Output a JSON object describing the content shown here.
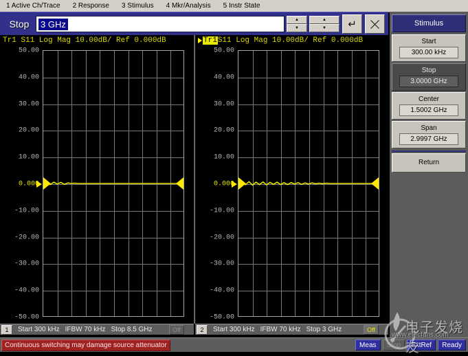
{
  "menubar": {
    "items": [
      {
        "label": "1 Active Ch/Trace"
      },
      {
        "label": "2 Response"
      },
      {
        "label": "3 Stimulus"
      },
      {
        "label": "4 Mkr/Analysis"
      },
      {
        "label": "5 Instr State"
      }
    ]
  },
  "entrybar": {
    "label": "Stop",
    "value": "3 GHz",
    "placeholder": "",
    "enter_icon": "↵",
    "close_icon": "close-x",
    "up_icon": "▲",
    "down_icon": "▼"
  },
  "channels": [
    {
      "trace_label": "Tr1 S11 Log Mag 10.00dB/ Ref 0.000dB",
      "active": false,
      "trace_name": "Tr1",
      "trace_rest": " S11 Log Mag 10.00dB/ Ref 0.000dB",
      "number": "1",
      "start": "Start 300 kHz",
      "ifbw": "IFBW 70 kHz",
      "stop": "Stop 8.5 GHz",
      "sweep_state": "Off",
      "sweep_state_active": false
    },
    {
      "trace_label": "Tr1 S11 Log Mag 10.00dB/ Ref 0.000dB",
      "active": true,
      "trace_name": "Tr1",
      "trace_rest": " S11 Log Mag 10.00dB/ Ref 0.000dB",
      "number": "2",
      "start": "Start 300 kHz",
      "ifbw": "IFBW 70 kHz",
      "stop": "Stop 3 GHz",
      "sweep_state": "Off",
      "sweep_state_active": true
    }
  ],
  "chart_data": [
    {
      "type": "line",
      "title": "Tr1 S11 Log Mag 10.00dB/ Ref 0.000dB",
      "channel": "1",
      "xlabel": "",
      "ylabel": "dB",
      "ylim": [
        -50,
        50
      ],
      "ytick_step": 10,
      "yticks": [
        "50.00",
        "40.00",
        "30.00",
        "20.00",
        "10.00",
        "0.000",
        "-10.00",
        "-20.00",
        "-30.00",
        "-40.00",
        "-50.00"
      ],
      "reference_value": "0.000",
      "reference_position": 0,
      "grid": true,
      "grid_divisions_x": 10,
      "grid_divisions_y": 10,
      "x_start": "300 kHz",
      "x_stop": "8.5 GHz",
      "series": [
        {
          "name": "Tr1 S11",
          "color": "#e8e800",
          "values": [
            0.0,
            0.3,
            -0.4,
            0.5,
            -0.2,
            0.4,
            -0.3,
            0.2,
            0.0,
            0.1,
            0.0,
            0.0,
            0.0,
            0.0,
            0.0,
            0.0,
            0.0,
            0.0,
            0.0,
            0.0,
            0.0,
            0.0,
            0.0,
            0.0,
            0.0,
            0.0,
            0.0,
            0.0,
            0.0,
            0.0,
            0.0,
            0.0,
            0.0,
            0.0,
            0.0,
            0.0,
            0.0,
            0.0,
            0.0,
            0.0,
            0.0
          ]
        }
      ]
    },
    {
      "type": "line",
      "title": "Tr1 S11 Log Mag 10.00dB/ Ref 0.000dB",
      "channel": "2",
      "xlabel": "",
      "ylabel": "dB",
      "ylim": [
        -50,
        50
      ],
      "ytick_step": 10,
      "yticks": [
        "50.00",
        "40.00",
        "30.00",
        "20.00",
        "10.00",
        "0.000",
        "-10.00",
        "-20.00",
        "-30.00",
        "-40.00",
        "-50.00"
      ],
      "reference_value": "0.000",
      "reference_position": 0,
      "grid": true,
      "grid_divisions_x": 10,
      "grid_divisions_y": 10,
      "x_start": "300 kHz",
      "x_stop": "3 GHz",
      "series": [
        {
          "name": "Tr1 S11",
          "color": "#e8e800",
          "values": [
            0.0,
            0.6,
            -0.5,
            0.7,
            -0.6,
            0.5,
            -0.4,
            0.6,
            -0.5,
            0.4,
            -0.3,
            0.5,
            -0.4,
            0.3,
            -0.4,
            0.3,
            -0.2,
            0.3,
            -0.3,
            0.2,
            -0.2,
            0.2,
            -0.1,
            0.1,
            -0.1,
            0.1,
            0.0,
            0.0,
            0.0,
            0.0,
            0.0,
            0.0,
            0.0,
            0.0,
            0.0,
            0.0,
            0.0,
            0.0,
            0.0,
            0.0,
            0.0
          ]
        }
      ]
    }
  ],
  "sidebar": {
    "title": "Stimulus",
    "keys": [
      {
        "label": "Start",
        "value": "300.00 kHz",
        "selected": false
      },
      {
        "label": "Stop",
        "value": "3.0000 GHz",
        "selected": true
      },
      {
        "label": "Center",
        "value": "1.5002 GHz",
        "selected": false
      },
      {
        "label": "Span",
        "value": "2.9997 GHz",
        "selected": false
      }
    ],
    "return_label": "Return"
  },
  "statusbar": {
    "warning": "Continuous switching may damage source attenuator",
    "indicators": [
      {
        "label": "Meas",
        "active": true
      },
      {
        "label": "Stop",
        "active": false
      },
      {
        "label": "ExtRef",
        "active": true
      },
      {
        "label": "Ready",
        "active": true
      }
    ]
  },
  "watermark": {
    "text": "电子发烧友",
    "url": "www.elecfans.com"
  }
}
